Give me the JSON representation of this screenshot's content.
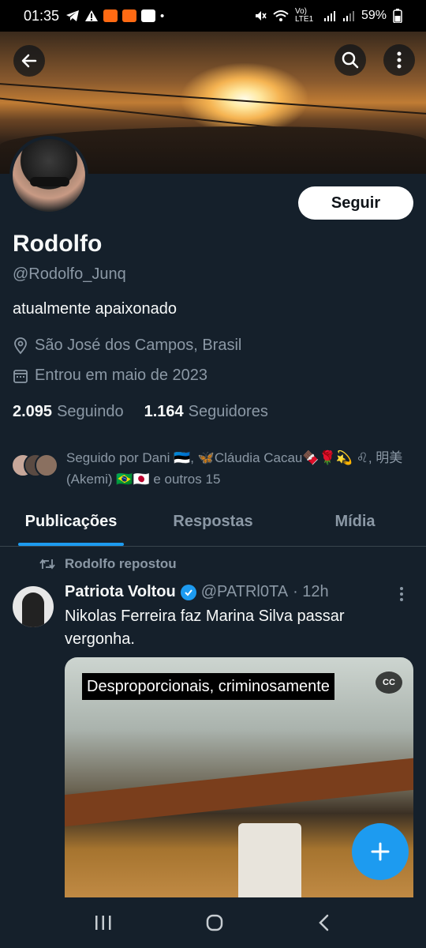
{
  "status_bar": {
    "time": "01:35",
    "network": "Vo) LTE1",
    "battery": "59%",
    "left_icons": [
      "telegram-icon",
      "warning-icon",
      "app-icon",
      "app-icon",
      "voicemail-icon"
    ],
    "right_icons": [
      "mute-icon",
      "wifi-icon",
      "signal-icon",
      "signal-icon",
      "battery-icon"
    ]
  },
  "header": {
    "back_icon": "arrow-left-icon",
    "search_icon": "search-icon",
    "more_icon": "more-vertical-icon"
  },
  "profile": {
    "follow_label": "Seguir",
    "name": "Rodolfo",
    "handle": "@Rodolfo_Junq",
    "bio": "atualmente apaixonado",
    "location": "São José dos Campos, Brasil",
    "joined": "Entrou em maio de 2023",
    "following_count": "2.095",
    "following_label": "Seguindo",
    "followers_count": "1.164",
    "followers_label": "Seguidores",
    "followed_by": "Seguido por Dani 🇪🇪, 🦋Cláudia Cacau🍫🌹💫 ♌, 明美 (Akemi) 🇧🇷🇯🇵 e outros 15"
  },
  "tabs": [
    {
      "label": "Publicações",
      "active": true
    },
    {
      "label": "Respostas",
      "active": false
    },
    {
      "label": "Mídia",
      "active": false
    }
  ],
  "post": {
    "repost_label": "Rodolfo repostou",
    "author": "Patriota Voltou",
    "handle": "@PATRl0TA",
    "time": "· 12h",
    "text": "Nikolas Ferreira faz Marina Silva passar vergonha.",
    "media_caption": "Desproporcionais, criminosamente",
    "cc_label": "CC"
  },
  "colors": {
    "background": "#15202b",
    "accent": "#1d9bf0",
    "muted_text": "#8b98a5",
    "divider": "#38444d"
  },
  "fab": {
    "icon": "plus-icon"
  },
  "nav": {
    "icons": [
      "recents-icon",
      "home-icon",
      "back-icon"
    ]
  }
}
